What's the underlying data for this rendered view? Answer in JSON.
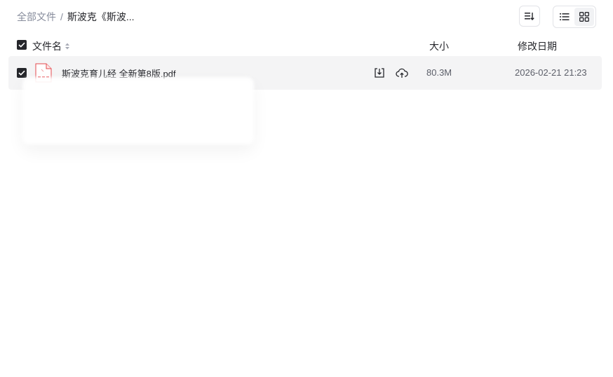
{
  "breadcrumb": {
    "root": "全部文件",
    "separator": "/",
    "current": "斯波克《斯波..."
  },
  "toolbar": {
    "sort_icon": "sort-icon",
    "list_view_icon": "list-view-icon",
    "grid_view_icon": "grid-view-icon"
  },
  "table": {
    "headers": {
      "name": "文件名",
      "size": "大小",
      "date": "修改日期"
    },
    "rows": [
      {
        "name": "斯波克育儿经 全新第8版.pdf",
        "size": "80.3M",
        "date": "2026-02-21 21:23",
        "checked": true
      }
    ]
  },
  "colors": {
    "accent_dark": "#25262b",
    "row_bg": "#f4f4f5",
    "muted": "#878c9c",
    "pdf_red": "#e5484d"
  }
}
